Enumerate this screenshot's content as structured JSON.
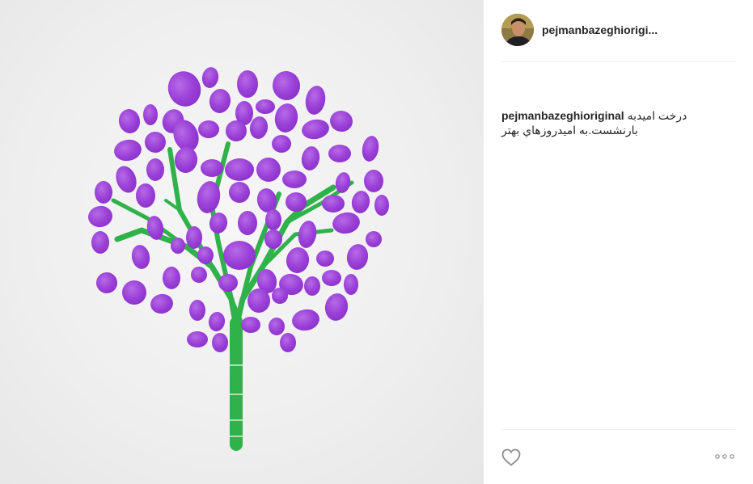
{
  "post": {
    "username": "pejmanbazeghiorigi...",
    "caption": {
      "username": "pejmanbazeghioriginal",
      "line1": "درخت امیدبه",
      "line2": "بارنشست.به امیدروزهاي بهتر"
    }
  },
  "icons": {
    "like": "heart-outline-icon",
    "options": "more-dots-icon"
  },
  "colors": {
    "leaf": "#9b45d6",
    "branch": "#2fb24a",
    "divider": "#efefef",
    "text": "#262626"
  }
}
